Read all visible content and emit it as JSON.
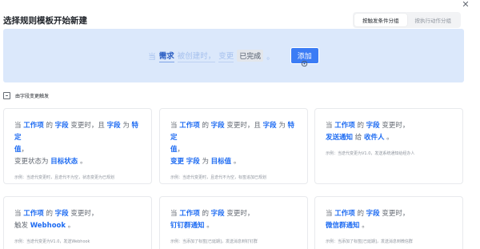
{
  "dialog": {
    "title": "选择规则模板开始新建",
    "close_icon": "close-icon",
    "tabs": [
      {
        "label": "按触发条件分组",
        "active": true
      },
      {
        "label": "按执行动作分组",
        "active": false
      }
    ]
  },
  "banner": {
    "t1": "当",
    "t2": "需求",
    "t3": "被创建时，",
    "t4": "变更",
    "t5": "已完成",
    "t6": "。",
    "add_label": "添加"
  },
  "section": {
    "icon": "field-change-icon",
    "label": "由字段变更触发"
  },
  "cards": [
    {
      "l1a": "当",
      "l1b": "工作项",
      "l1c": "的",
      "l1d": "字段",
      "l1e": "变更时，且",
      "l1f": "字段",
      "l1g": "为",
      "l1h": "特定",
      "l2a": "值",
      "l2b": "，",
      "l3a": "变更状态为",
      "l3b": "目标状态",
      "l3c": "。",
      "example": "示例：当迭代变更时，且迭代不为空，状态变更为已规划"
    },
    {
      "l1a": "当",
      "l1b": "工作项",
      "l1c": "的",
      "l1d": "字段",
      "l1e": "变更时，且",
      "l1f": "字段",
      "l1g": "为",
      "l1h": "特定",
      "l2a": "值",
      "l2b": "，",
      "l3a": "变更",
      "l3b": "字段",
      "l3c": "为",
      "l3d": "目标值",
      "l3e": "。",
      "example": "示例：当迭代变更时，且迭代不为空，标签追加已规划"
    },
    {
      "l1a": "当",
      "l1b": "工作项",
      "l1c": "的",
      "l1d": "字段",
      "l1e": "变更时，",
      "l2a": "发送通知",
      "l2b": "给",
      "l2c": "收件人",
      "l2d": "。",
      "example": "示例：当迭代变更为V1.0，发送系统通知给经办人"
    },
    {
      "l1a": "当",
      "l1b": "工作项",
      "l1c": "的",
      "l1d": "字段",
      "l1e": "变更时，",
      "l2a": "触发",
      "l2b": "Webhook",
      "l2c": "。",
      "example": "示例：当迭代变更为V1.0，发送Webhook"
    },
    {
      "l1a": "当",
      "l1b": "工作项",
      "l1c": "的",
      "l1d": "字段",
      "l1e": "变更时，",
      "l2a": "钉钉群通知",
      "l2b": "。",
      "example": "示例：当添加了标签[已延期]，发送消息到钉钉群"
    },
    {
      "l1a": "当",
      "l1b": "工作项",
      "l1c": "的",
      "l1d": "字段",
      "l1e": "变更时，",
      "l2a": "微信群通知",
      "l2b": "。",
      "example": "示例：当添加了标签[已延期]，发送消息到微信群"
    }
  ],
  "colors": {
    "accent": "#1d6bf2",
    "banner_bg": "#dbe8fb",
    "button": "#3b7cf5"
  }
}
